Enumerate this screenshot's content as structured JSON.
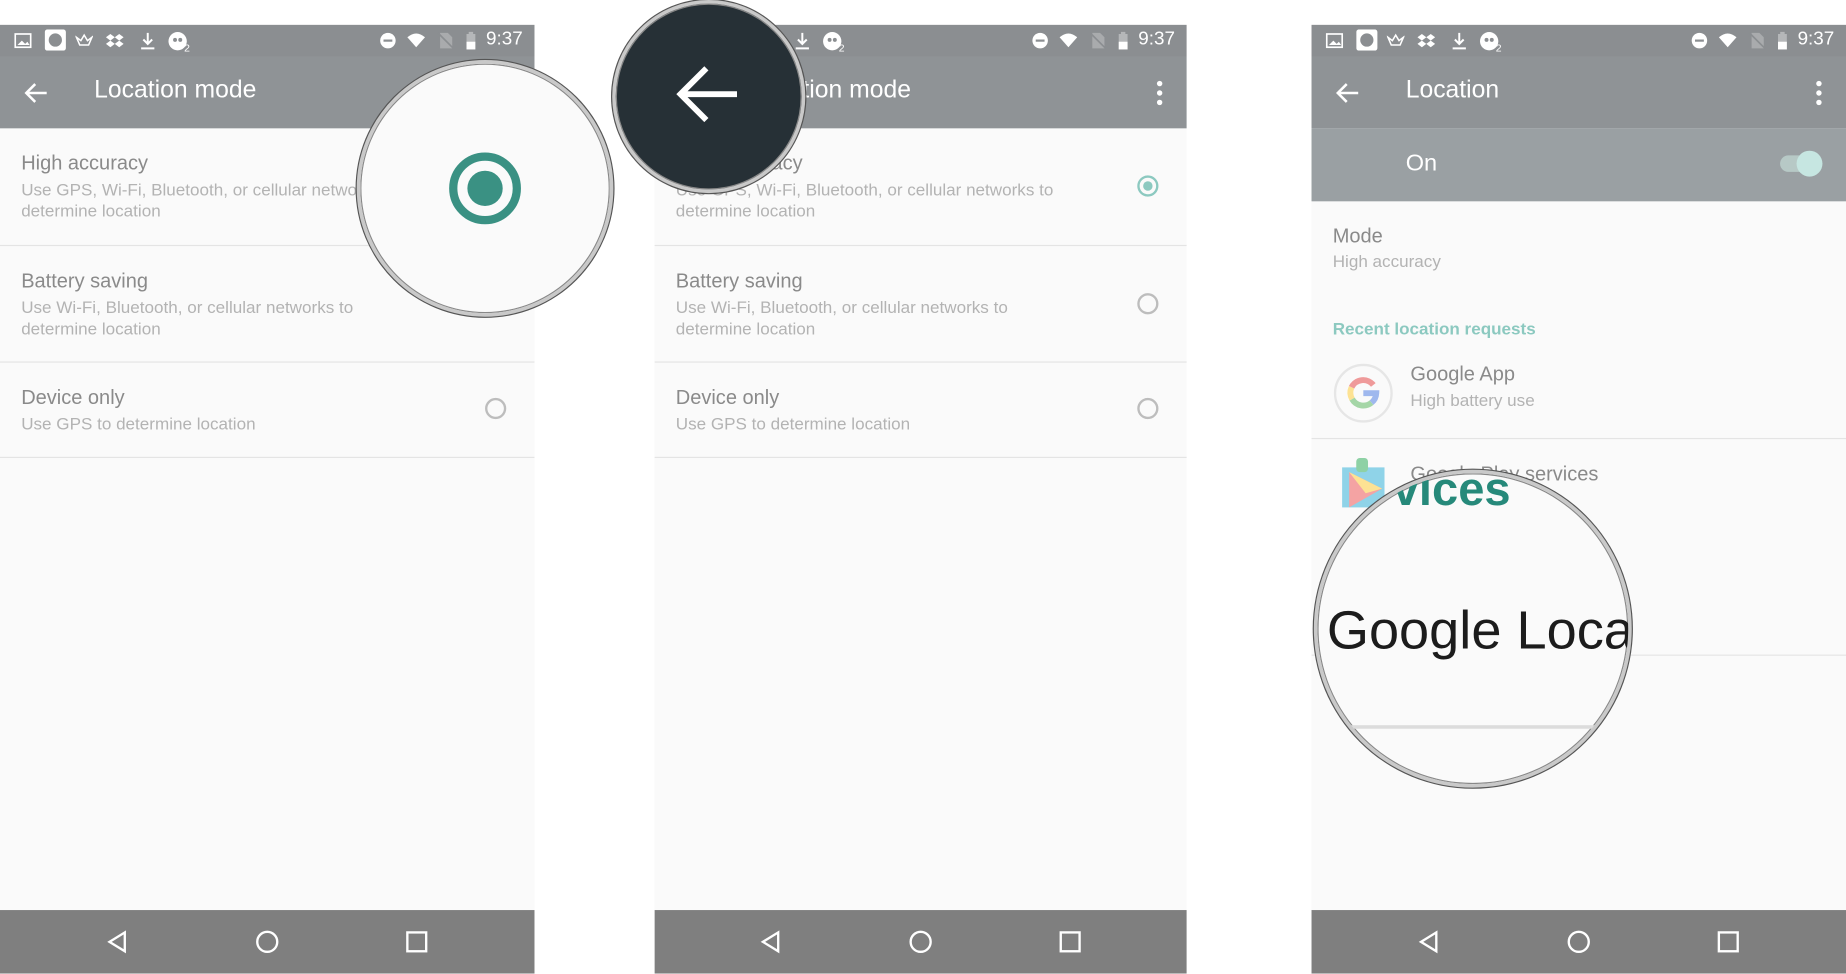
{
  "status_bar": {
    "time": "9:37",
    "icons": [
      "image-icon",
      "maps-icon",
      "crown-icon",
      "dropbox-icon",
      "download-icon",
      "zombie-icon",
      "dnd-icon",
      "wifi-icon",
      "no-sim-icon",
      "battery-icon"
    ]
  },
  "panel1": {
    "title": "Location mode",
    "options": [
      {
        "title": "High accuracy",
        "subtitle": "Use GPS, Wi-Fi, Bluetooth, or cellular networks to determine location",
        "selected": true
      },
      {
        "title": "Battery saving",
        "subtitle": "Use Wi-Fi, Bluetooth, or cellular networks to determine location",
        "selected": false
      },
      {
        "title": "Device only",
        "subtitle": "Use GPS to determine location",
        "selected": false
      }
    ]
  },
  "panel2": {
    "title": "Location mode",
    "options": [
      {
        "title": "High accuracy",
        "subtitle": "Use GPS, Wi-Fi, Bluetooth, or cellular networks to determine location",
        "selected": true
      },
      {
        "title": "Battery saving",
        "subtitle": "Use Wi-Fi, Bluetooth, or cellular networks to determine location",
        "selected": false
      },
      {
        "title": "Device only",
        "subtitle": "Use GPS to determine location",
        "selected": false
      }
    ]
  },
  "panel3": {
    "title": "Location",
    "master_switch": {
      "label": "On",
      "on": true
    },
    "mode": {
      "title": "Mode",
      "value": "High accuracy"
    },
    "recent_header": "Recent location requests",
    "apps": [
      {
        "name": "Google App",
        "detail": "High battery use",
        "icon": "google-g-icon"
      },
      {
        "name": "Google Play services",
        "detail": "",
        "icon": "play-services-icon"
      }
    ],
    "magnifier": {
      "text_top": "vices",
      "text_main": "Google Loca"
    }
  },
  "colors": {
    "accent": "#26897a",
    "accent_dim": "#8cc9c0",
    "toolbar": "#8f9396",
    "navbar": "#7f7f7f",
    "magnifier_dark": "#263036"
  }
}
